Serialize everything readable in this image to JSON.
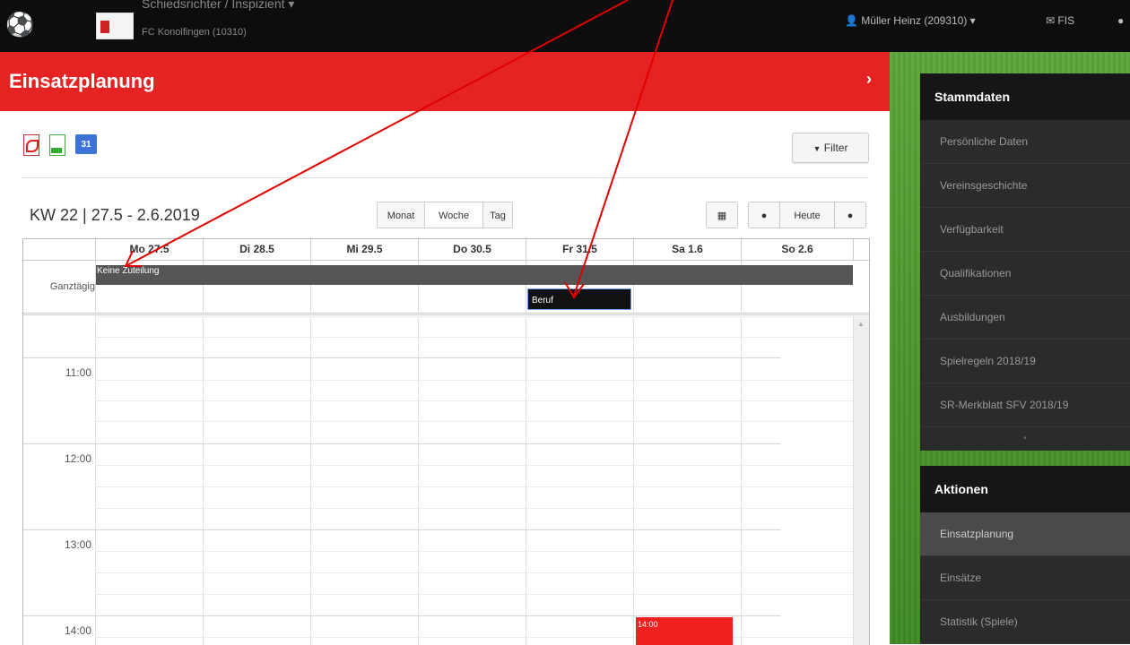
{
  "topbar": {
    "role": "Schiedsrichter / Inspizient ▾",
    "club": "FC Konolfingen (10310)",
    "user": "Müller Heinz (209310) ▾",
    "user_icon": "👤",
    "fis": "FIS",
    "fis_icon": "✉"
  },
  "header": {
    "title": "Einsatzplanung",
    "chevron": "›"
  },
  "toolbar": {
    "export_icons": [
      "pdf-icon",
      "excel-icon",
      "google-calendar-icon"
    ],
    "calendar_badge": "31",
    "filter_label": "Filter",
    "filter_icon": "▼"
  },
  "calendar": {
    "week_title": "KW 22 | 27.5 - 2.6.2019",
    "views": {
      "month": "Monat",
      "week": "Woche",
      "day": "Tag"
    },
    "active_view": "Woche",
    "today_label": "Heute",
    "days": [
      "Mo 27.5",
      "Di 28.5",
      "Mi 29.5",
      "Do 30.5",
      "Fr 31.5",
      "Sa 1.6",
      "So 2.6"
    ],
    "allday_label": "Ganztägig",
    "events": {
      "all_week": "Keine Zuteilung",
      "friday": "Beruf",
      "saturday_time": "14:00"
    },
    "hours": [
      "11:00",
      "12:00",
      "13:00",
      "14:00"
    ]
  },
  "sidebar": {
    "stammdaten": {
      "title": "Stammdaten",
      "items": [
        "Persönliche Daten",
        "Vereinsgeschichte",
        "Verfügbarkeit",
        "Qualifikationen",
        "Ausbildungen",
        "Spielregeln 2018/19",
        "SR-Merkblatt SFV 2018/19"
      ]
    },
    "aktionen": {
      "title": "Aktionen",
      "items": [
        "Einsatzplanung",
        "Einsätze",
        "Statistik (Spiele)"
      ],
      "active": "Einsatzplanung"
    }
  },
  "colors": {
    "brand_red": "#e52322",
    "annotation": "#e00000",
    "event_dark": "#555555",
    "event_red": "#f12121"
  }
}
